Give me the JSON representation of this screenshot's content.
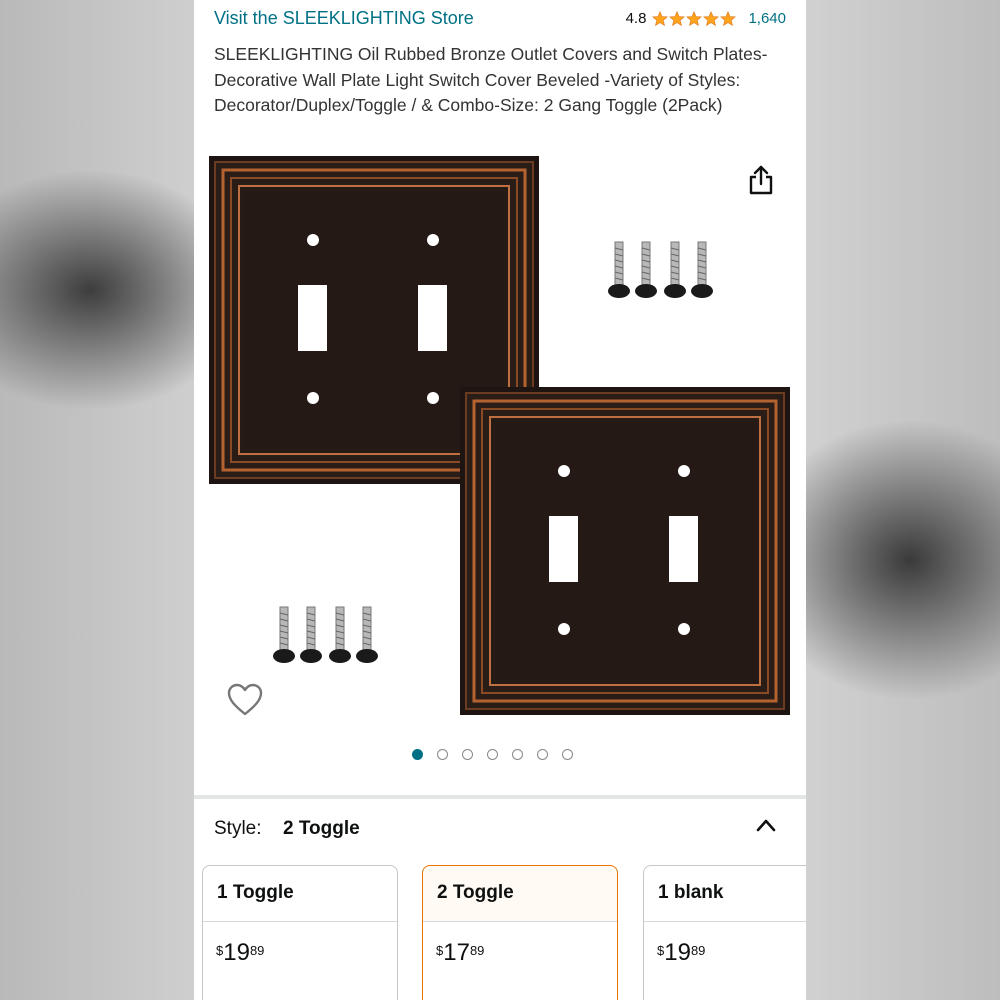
{
  "header": {
    "store_link": "Visit the SLEEKLIGHTING Store",
    "rating_value": "4.8",
    "rating_stars": 4.8,
    "rating_count": "1,640"
  },
  "product": {
    "title": "SLEEKLIGHTING Oil Rubbed Bronze Outlet Covers and Switch Plates-Decorative Wall Plate Light Switch Cover Beveled -Variety of Styles: Decorator/Duplex/Toggle / & Combo-Size: 2 Gang Toggle (2Pack)"
  },
  "gallery": {
    "image_count": 7,
    "active_index": 0,
    "icons": [
      "share-icon",
      "heart-icon"
    ]
  },
  "style_selector": {
    "label": "Style:",
    "selected": "2 Toggle",
    "options": [
      {
        "name": "1 Toggle",
        "currency": "$",
        "whole": "19",
        "fraction": "89"
      },
      {
        "name": "2 Toggle",
        "currency": "$",
        "whole": "17",
        "fraction": "89"
      },
      {
        "name": "1 blank",
        "currency": "$",
        "whole": "19",
        "fraction": "89"
      }
    ]
  },
  "colors": {
    "link": "#007185",
    "star": "#ffa41c",
    "selected_border": "#e77600",
    "bronze": "#2b1e19",
    "copper": "#b4622e"
  }
}
